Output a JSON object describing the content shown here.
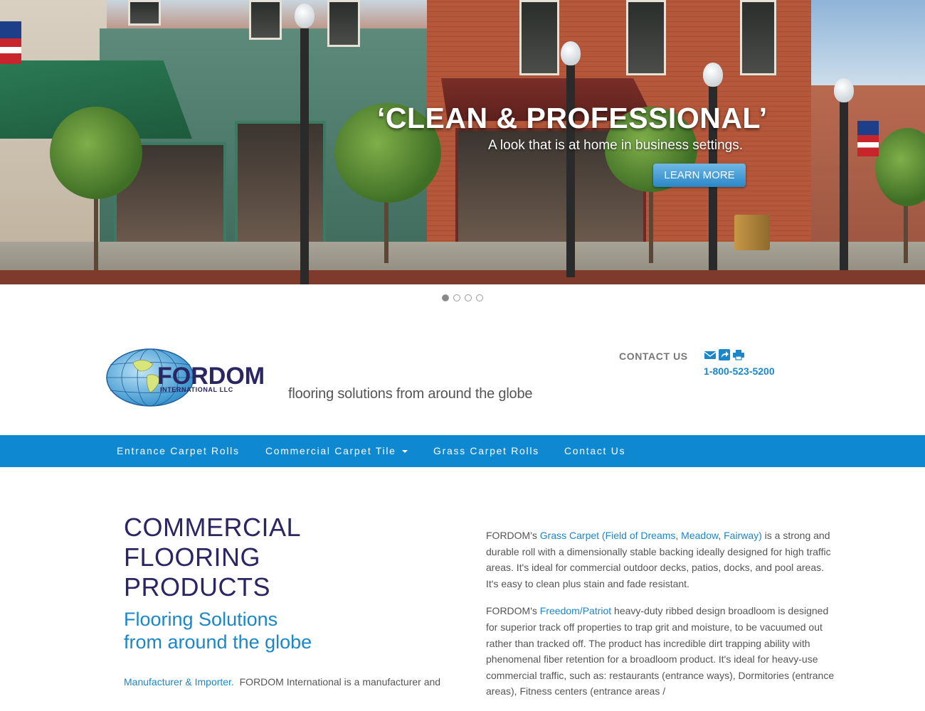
{
  "hero": {
    "title": "‘CLEAN & PROFESSIONAL’",
    "subtitle": "A look that is at home in business settings.",
    "button_label": "LEARN MORE",
    "slide_count": 4,
    "active_slide": 1
  },
  "header": {
    "logo_text": "FORDOM",
    "logo_subtext": "INTERNATIONAL LLC",
    "tagline": "flooring solutions from around the globe",
    "contact_label": "CONTACT US",
    "phone": "1-800-523-5200",
    "icons": [
      "envelope-icon",
      "share-icon",
      "print-icon"
    ]
  },
  "nav": {
    "items": [
      {
        "label": "Entrance Carpet Rolls"
      },
      {
        "label": "Commercial Carpet Tile",
        "dropdown": true
      },
      {
        "label": "Grass Carpet Rolls"
      },
      {
        "label": "Contact Us"
      }
    ]
  },
  "main": {
    "heading_lines": [
      "COMMERCIAL",
      "FLOORING",
      "PRODUCTS"
    ],
    "subheading_lines": [
      "Flooring Solutions",
      "from around the globe"
    ],
    "left_link": "Manufacturer & Importer.",
    "left_text": "  FORDOM International is a manufacturer and",
    "p1": {
      "prefix": "FORDOM's ",
      "link_main": "Grass Carpet (Field of Dreams",
      "sep1": ", ",
      "link_meadow": "Meadow",
      "sep2": ", ",
      "link_fairway": "Fairway)",
      "rest": " is a strong and durable roll with a dimensionally stable backing ideally designed for high traffic areas. It's ideal for commercial outdoor decks, patios, docks, and pool areas. It's easy to clean plus stain and fade resistant."
    },
    "p2": {
      "prefix": "FORDOM's ",
      "link": "Freedom/Patriot",
      "rest": " heavy-duty ribbed design broadloom is designed for superior track off properties to trap grit and moisture, to be vacuumed out rather than tracked off. The product has incredible dirt trapping ability with phenomenal fiber retention for a broadloom product. It's ideal for heavy-use commercial traffic, such as: restaurants (entrance ways), Dormitories (entrance areas), Fitness centers (entrance areas /"
    }
  },
  "colors": {
    "nav_bg": "#0f88d2",
    "heading": "#2a2563",
    "accent": "#1b87c9",
    "body_text": "#555555"
  }
}
